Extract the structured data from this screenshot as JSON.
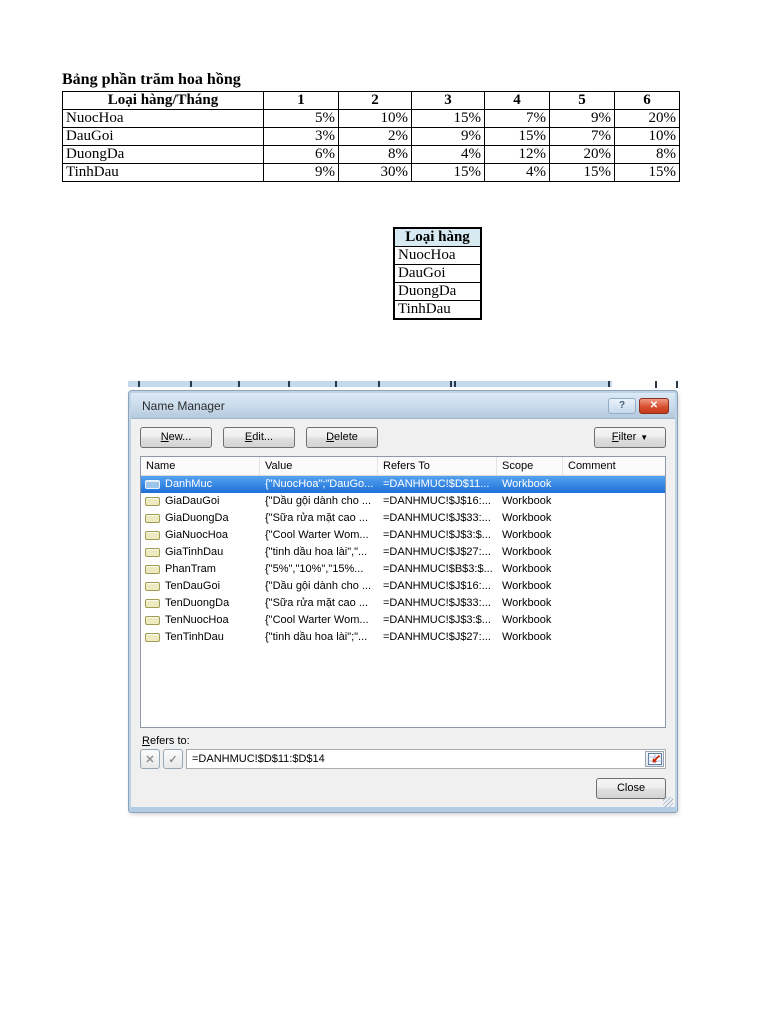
{
  "document": {
    "commission_table": {
      "title": "Bảng phần trăm hoa hồng",
      "header": [
        "Loại hàng/Tháng",
        "1",
        "2",
        "3",
        "4",
        "5",
        "6"
      ],
      "rows": [
        {
          "label": "NuocHoa",
          "values": [
            "5%",
            "10%",
            "15%",
            "7%",
            "9%",
            "20%"
          ]
        },
        {
          "label": "DauGoi",
          "values": [
            "3%",
            "2%",
            "9%",
            "15%",
            "7%",
            "10%"
          ]
        },
        {
          "label": "DuongDa",
          "values": [
            "6%",
            "8%",
            "4%",
            "12%",
            "20%",
            "8%"
          ]
        },
        {
          "label": "TinhDau",
          "values": [
            "9%",
            "30%",
            "15%",
            "4%",
            "15%",
            "15%"
          ]
        }
      ]
    },
    "category_table": {
      "header": "Loại hàng",
      "header_bg": "#D7E9F1",
      "rows": [
        "NuocHoa",
        "DauGoi",
        "DuongDa",
        "TinhDau"
      ]
    }
  },
  "name_manager": {
    "title": "Name Manager",
    "titlebar_icons": {
      "help": "?",
      "close": "✕"
    },
    "toolbar": {
      "new": {
        "m": "N",
        "rest": "ew..."
      },
      "edit": {
        "m": "E",
        "rest": "dit..."
      },
      "delete": {
        "m": "D",
        "rest": "elete"
      },
      "filter": {
        "m": "F",
        "rest": "ilter"
      },
      "filter_arrow": "▼"
    },
    "columns": [
      "Name",
      "Value",
      "Refers To",
      "Scope",
      "Comment"
    ],
    "names": [
      {
        "name": "DanhMuc",
        "value": "{\"NuocHoa\";\"DauGo...",
        "refers_to": "=DANHMUC!$D$11...",
        "scope": "Workbook",
        "comment": ""
      },
      {
        "name": "GiaDauGoi",
        "value": "{\"Dầu gội dành cho ...",
        "refers_to": "=DANHMUC!$J$16:...",
        "scope": "Workbook",
        "comment": ""
      },
      {
        "name": "GiaDuongDa",
        "value": "{\"Sữa rửa mặt cao ...",
        "refers_to": "=DANHMUC!$J$33:...",
        "scope": "Workbook",
        "comment": ""
      },
      {
        "name": "GiaNuocHoa",
        "value": "{\"Cool Warter Wom...",
        "refers_to": "=DANHMUC!$J$3:$...",
        "scope": "Workbook",
        "comment": ""
      },
      {
        "name": "GiaTinhDau",
        "value": "{\"tinh dầu hoa lài\",\"...",
        "refers_to": "=DANHMUC!$J$27:...",
        "scope": "Workbook",
        "comment": ""
      },
      {
        "name": "PhanTram",
        "value": "{\"5%\",\"10%\",\"15%...",
        "refers_to": "=DANHMUC!$B$3:$...",
        "scope": "Workbook",
        "comment": ""
      },
      {
        "name": "TenDauGoi",
        "value": "{\"Dầu gội dành cho ...",
        "refers_to": "=DANHMUC!$J$16:...",
        "scope": "Workbook",
        "comment": ""
      },
      {
        "name": "TenDuongDa",
        "value": "{\"Sữa rửa mặt cao ...",
        "refers_to": "=DANHMUC!$J$33:...",
        "scope": "Workbook",
        "comment": ""
      },
      {
        "name": "TenNuocHoa",
        "value": "{\"Cool Warter Wom...",
        "refers_to": "=DANHMUC!$J$3:$...",
        "scope": "Workbook",
        "comment": ""
      },
      {
        "name": "TenTinhDau",
        "value": "{\"tinh dầu hoa lài\";\"...",
        "refers_to": "=DANHMUC!$J$27:...",
        "scope": "Workbook",
        "comment": ""
      }
    ],
    "selected_name": "DanhMuc",
    "refers_to": {
      "label": {
        "m": "R",
        "rest": "efers to:"
      },
      "cancel_glyph": "✕",
      "enter_glyph": "✓",
      "value": "=DANHMUC!$D$11:$D$14"
    },
    "close_label": "Close",
    "colors": {
      "selection": "#2E86E0",
      "titlebar": "#C7D9EA",
      "close_button_red": "#C33A1C"
    }
  }
}
